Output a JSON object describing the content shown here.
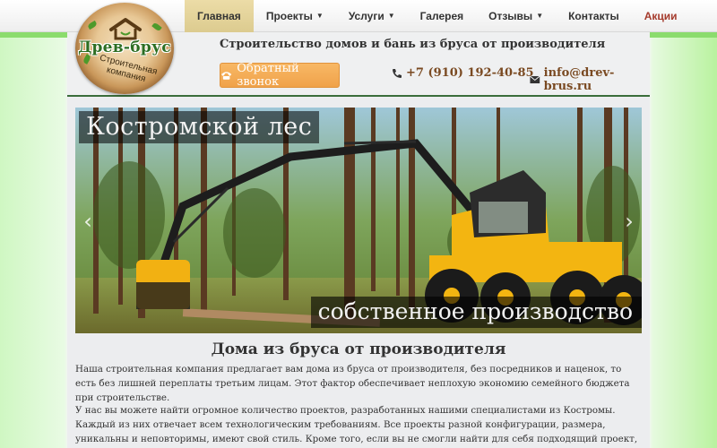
{
  "nav": {
    "items": [
      {
        "label": "Главная",
        "dropdown": false,
        "active": true
      },
      {
        "label": "Проекты",
        "dropdown": true
      },
      {
        "label": "Услуги",
        "dropdown": true
      },
      {
        "label": "Галерея",
        "dropdown": false
      },
      {
        "label": "Отзывы",
        "dropdown": true
      },
      {
        "label": "Контакты",
        "dropdown": false
      },
      {
        "label": "Акции",
        "dropdown": false,
        "promo": true
      }
    ],
    "caret_glyph": "▼"
  },
  "logo": {
    "name": "Древ-брус",
    "subtitle": "Строительная компания"
  },
  "header": {
    "tagline": "Строительство домов и бань из бруса от производителя",
    "callback_label": "Обратный звонок",
    "phone": "+7 (910) 192-40-85",
    "email": "info@drev-brus.ru"
  },
  "carousel": {
    "caption_top": "Костромской лес",
    "caption_bottom": "собственное производство",
    "prev_icon": "‹",
    "next_icon": "›"
  },
  "content": {
    "title": "Дома из бруса от производителя",
    "paragraph1": "Наша строительная компания предлагает вам дома из бруса от производителя, без посредников и наценок, то есть без лишней переплаты третьим лицам. Этот фактор обеспечивает неплохую экономию семейного бюджета при строительстве.",
    "paragraph2": "У нас вы можете найти огромное количество проектов, разработанных нашими специалистами из Костромы. Каждый из них отвечает всем технологическим требованиям. Все проекты разной конфигурации, размера, уникальны и неповторимы, имеют свой стиль. Кроме того, если вы не смогли найти для себя подходящий проект, удовлетворяющий всем требованиям, то мы с удовольствием спроектируем"
  },
  "colors": {
    "accent_green": "#3a6d3a",
    "button_orange": "#f0a24a",
    "link_brown": "#7a4a22",
    "promo_red": "#a53b2d"
  }
}
